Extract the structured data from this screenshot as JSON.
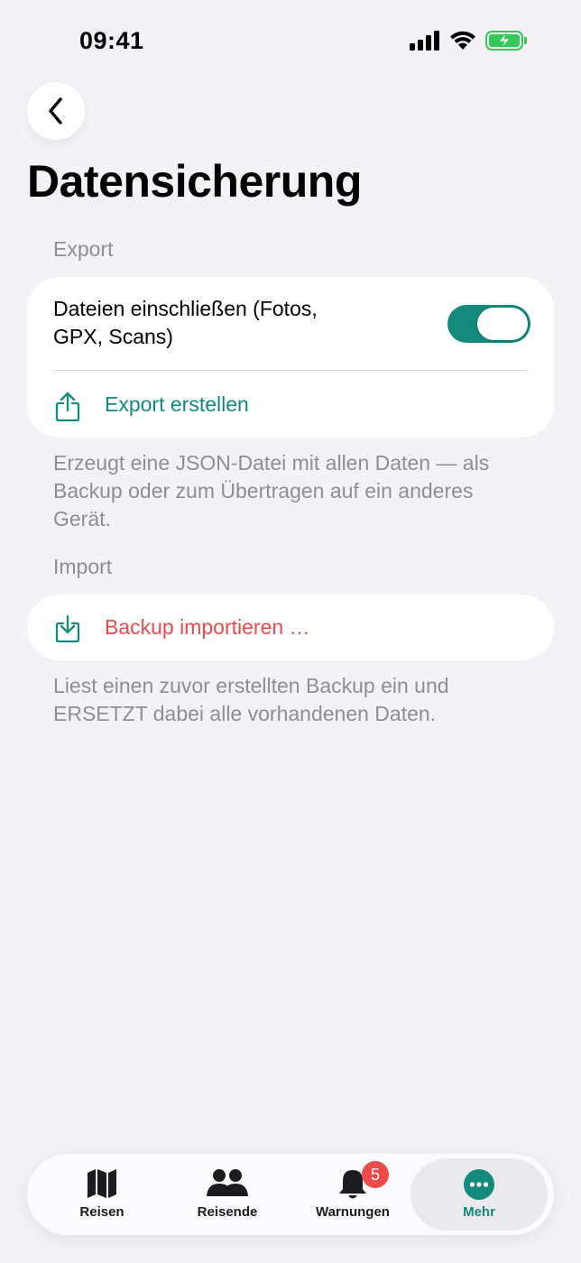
{
  "status_bar": {
    "time": "09:41"
  },
  "header": {
    "title": "Datensicherung"
  },
  "export_section": {
    "label": "Export",
    "include_files_label": "Dateien einschließen (Fotos, GPX, Scans)",
    "include_files_enabled": true,
    "export_action_label": "Export erstellen",
    "footnote": "Erzeugt eine JSON-Datei mit allen Daten — als Backup oder zum Übertragen auf ein anderes Gerät."
  },
  "import_section": {
    "label": "Import",
    "import_action_label": "Backup importieren …",
    "footnote": "Liest einen zuvor erstellten Backup ein und ERSETZT dabei alle vorhandenen Daten."
  },
  "tab_bar": {
    "tabs": [
      {
        "label": "Reisen",
        "icon": "map-icon"
      },
      {
        "label": "Reisende",
        "icon": "people-icon"
      },
      {
        "label": "Warnungen",
        "icon": "bell-icon",
        "badge": "5"
      },
      {
        "label": "Mehr",
        "icon": "more-icon",
        "active": true
      }
    ]
  },
  "colors": {
    "accent": "#138a7c",
    "destructive": "#e84b4b",
    "background": "#f2f2f7",
    "badge": "#f04a4a"
  }
}
